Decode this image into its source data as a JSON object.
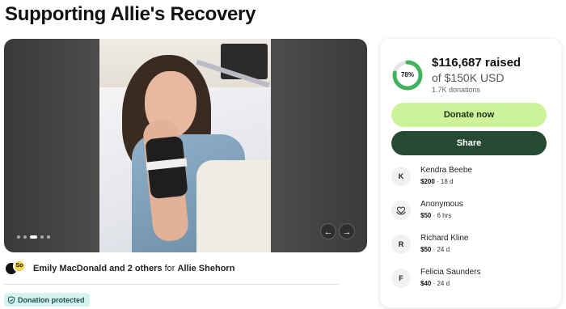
{
  "page": {
    "title": "Supporting Allie's Recovery"
  },
  "gallery": {
    "photo_alt": "photo",
    "dots_count": 5,
    "active_dot": 2,
    "prev_icon": "chevron-left-icon",
    "next_icon": "chevron-right-icon",
    "prev_glyph": "←",
    "next_glyph": "→"
  },
  "organizer": {
    "names": "Emily MacDonald and 2 others",
    "for_word": "for",
    "beneficiary": "Allie Shehorn",
    "badge_text": "So"
  },
  "protection": {
    "label": "Donation protected"
  },
  "progress": {
    "raised": "$116,687 raised",
    "goal": "of $150K USD",
    "donations": "1.7K donations",
    "percent_label": "78%",
    "percent_value": 0.78,
    "ring_color": "#41b35d",
    "ring_track": "#e5e5e5"
  },
  "actions": {
    "donate": "Donate now",
    "share": "Share"
  },
  "donors": [
    {
      "initial": "K",
      "name": "Kendra Beebe",
      "amount": "$200",
      "time": "18 d"
    },
    {
      "initial": "",
      "icon": "hands-heart-icon",
      "name": "Anonymous",
      "amount": "$50",
      "time": "6 hrs"
    },
    {
      "initial": "R",
      "name": "Richard Kline",
      "amount": "$50",
      "time": "24 d"
    },
    {
      "initial": "F",
      "name": "Felicia Saunders",
      "amount": "$40",
      "time": "24 d"
    }
  ],
  "colors": {
    "donate_bg": "#cdf39a",
    "share_bg": "#274a35",
    "protected_bg": "#d4f2f0"
  }
}
